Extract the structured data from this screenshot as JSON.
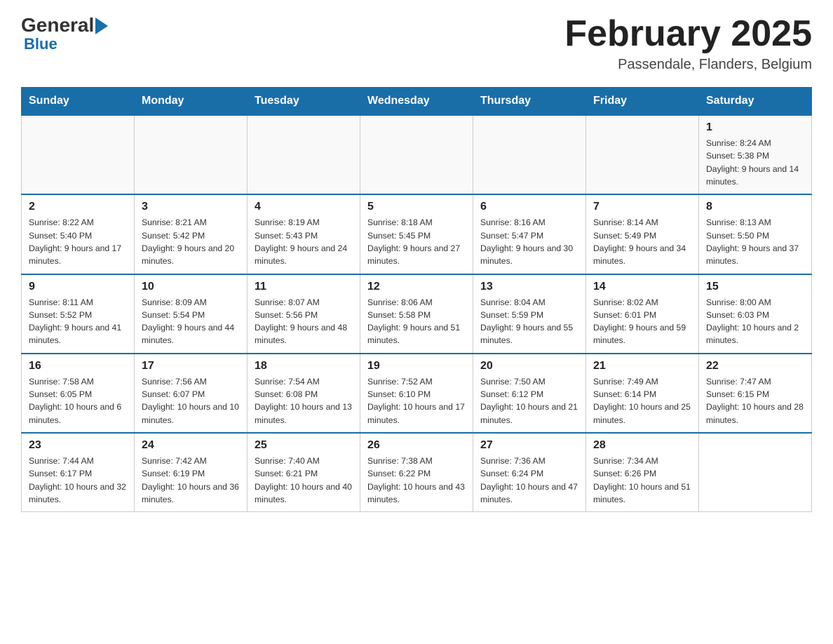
{
  "header": {
    "logo_general": "General",
    "logo_blue": "Blue",
    "title": "February 2025",
    "location": "Passendale, Flanders, Belgium"
  },
  "days_of_week": [
    "Sunday",
    "Monday",
    "Tuesday",
    "Wednesday",
    "Thursday",
    "Friday",
    "Saturday"
  ],
  "weeks": [
    {
      "days": [
        {
          "date": "",
          "info": ""
        },
        {
          "date": "",
          "info": ""
        },
        {
          "date": "",
          "info": ""
        },
        {
          "date": "",
          "info": ""
        },
        {
          "date": "",
          "info": ""
        },
        {
          "date": "",
          "info": ""
        },
        {
          "date": "1",
          "info": "Sunrise: 8:24 AM\nSunset: 5:38 PM\nDaylight: 9 hours and 14 minutes."
        }
      ]
    },
    {
      "days": [
        {
          "date": "2",
          "info": "Sunrise: 8:22 AM\nSunset: 5:40 PM\nDaylight: 9 hours and 17 minutes."
        },
        {
          "date": "3",
          "info": "Sunrise: 8:21 AM\nSunset: 5:42 PM\nDaylight: 9 hours and 20 minutes."
        },
        {
          "date": "4",
          "info": "Sunrise: 8:19 AM\nSunset: 5:43 PM\nDaylight: 9 hours and 24 minutes."
        },
        {
          "date": "5",
          "info": "Sunrise: 8:18 AM\nSunset: 5:45 PM\nDaylight: 9 hours and 27 minutes."
        },
        {
          "date": "6",
          "info": "Sunrise: 8:16 AM\nSunset: 5:47 PM\nDaylight: 9 hours and 30 minutes."
        },
        {
          "date": "7",
          "info": "Sunrise: 8:14 AM\nSunset: 5:49 PM\nDaylight: 9 hours and 34 minutes."
        },
        {
          "date": "8",
          "info": "Sunrise: 8:13 AM\nSunset: 5:50 PM\nDaylight: 9 hours and 37 minutes."
        }
      ]
    },
    {
      "days": [
        {
          "date": "9",
          "info": "Sunrise: 8:11 AM\nSunset: 5:52 PM\nDaylight: 9 hours and 41 minutes."
        },
        {
          "date": "10",
          "info": "Sunrise: 8:09 AM\nSunset: 5:54 PM\nDaylight: 9 hours and 44 minutes."
        },
        {
          "date": "11",
          "info": "Sunrise: 8:07 AM\nSunset: 5:56 PM\nDaylight: 9 hours and 48 minutes."
        },
        {
          "date": "12",
          "info": "Sunrise: 8:06 AM\nSunset: 5:58 PM\nDaylight: 9 hours and 51 minutes."
        },
        {
          "date": "13",
          "info": "Sunrise: 8:04 AM\nSunset: 5:59 PM\nDaylight: 9 hours and 55 minutes."
        },
        {
          "date": "14",
          "info": "Sunrise: 8:02 AM\nSunset: 6:01 PM\nDaylight: 9 hours and 59 minutes."
        },
        {
          "date": "15",
          "info": "Sunrise: 8:00 AM\nSunset: 6:03 PM\nDaylight: 10 hours and 2 minutes."
        }
      ]
    },
    {
      "days": [
        {
          "date": "16",
          "info": "Sunrise: 7:58 AM\nSunset: 6:05 PM\nDaylight: 10 hours and 6 minutes."
        },
        {
          "date": "17",
          "info": "Sunrise: 7:56 AM\nSunset: 6:07 PM\nDaylight: 10 hours and 10 minutes."
        },
        {
          "date": "18",
          "info": "Sunrise: 7:54 AM\nSunset: 6:08 PM\nDaylight: 10 hours and 13 minutes."
        },
        {
          "date": "19",
          "info": "Sunrise: 7:52 AM\nSunset: 6:10 PM\nDaylight: 10 hours and 17 minutes."
        },
        {
          "date": "20",
          "info": "Sunrise: 7:50 AM\nSunset: 6:12 PM\nDaylight: 10 hours and 21 minutes."
        },
        {
          "date": "21",
          "info": "Sunrise: 7:49 AM\nSunset: 6:14 PM\nDaylight: 10 hours and 25 minutes."
        },
        {
          "date": "22",
          "info": "Sunrise: 7:47 AM\nSunset: 6:15 PM\nDaylight: 10 hours and 28 minutes."
        }
      ]
    },
    {
      "days": [
        {
          "date": "23",
          "info": "Sunrise: 7:44 AM\nSunset: 6:17 PM\nDaylight: 10 hours and 32 minutes."
        },
        {
          "date": "24",
          "info": "Sunrise: 7:42 AM\nSunset: 6:19 PM\nDaylight: 10 hours and 36 minutes."
        },
        {
          "date": "25",
          "info": "Sunrise: 7:40 AM\nSunset: 6:21 PM\nDaylight: 10 hours and 40 minutes."
        },
        {
          "date": "26",
          "info": "Sunrise: 7:38 AM\nSunset: 6:22 PM\nDaylight: 10 hours and 43 minutes."
        },
        {
          "date": "27",
          "info": "Sunrise: 7:36 AM\nSunset: 6:24 PM\nDaylight: 10 hours and 47 minutes."
        },
        {
          "date": "28",
          "info": "Sunrise: 7:34 AM\nSunset: 6:26 PM\nDaylight: 10 hours and 51 minutes."
        },
        {
          "date": "",
          "info": ""
        }
      ]
    }
  ]
}
